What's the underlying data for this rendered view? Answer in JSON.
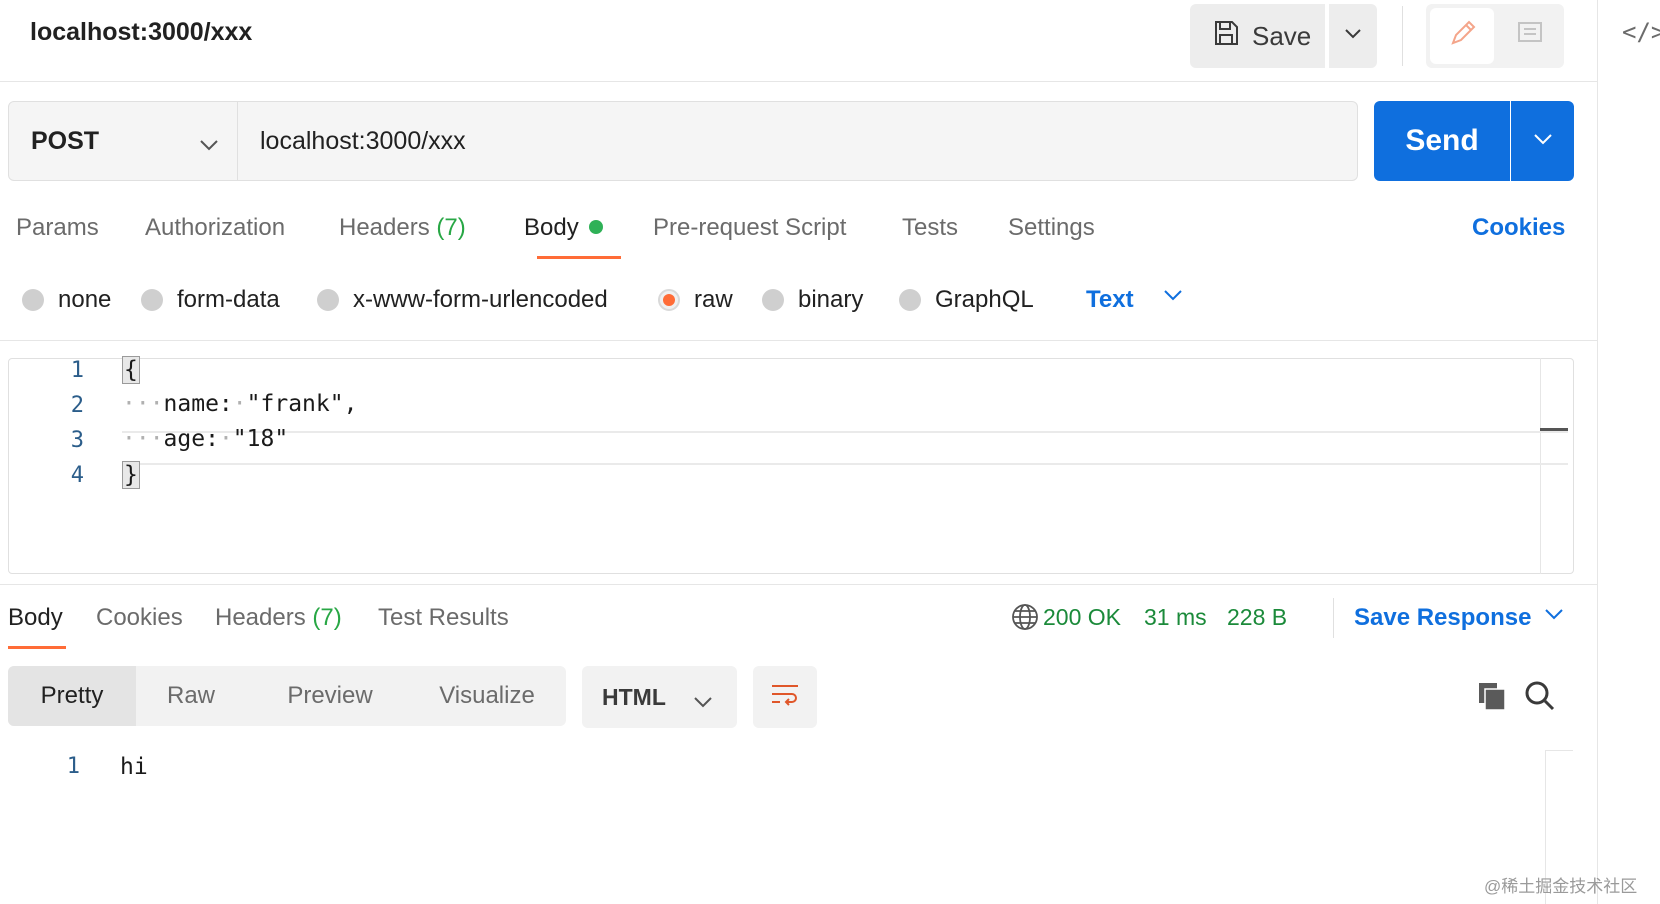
{
  "window": {
    "title": "localhost:3000/xxx"
  },
  "toolbar": {
    "save_label": "Save"
  },
  "request": {
    "method": "POST",
    "url": "localhost:3000/xxx",
    "send_label": "Send"
  },
  "request_tabs": [
    {
      "label": "Params"
    },
    {
      "label": "Authorization"
    },
    {
      "label": "Headers",
      "count": "(7)"
    },
    {
      "label": "Body"
    },
    {
      "label": "Pre-request Script"
    },
    {
      "label": "Tests"
    },
    {
      "label": "Settings"
    }
  ],
  "cookies_label": "Cookies",
  "body_types": [
    {
      "label": "none"
    },
    {
      "label": "form-data"
    },
    {
      "label": "x-www-form-urlencoded"
    },
    {
      "label": "raw"
    },
    {
      "label": "binary"
    },
    {
      "label": "GraphQL"
    }
  ],
  "body_format": "Text",
  "request_body": {
    "line_numbers": [
      "1",
      "2",
      "3",
      "4"
    ],
    "line1": "{",
    "line2_indent": "···",
    "line2_code": "name:",
    "line2_ws": "·",
    "line2_value": "\"frank\",",
    "line3_indent": "···",
    "line3_code": "age:",
    "line3_ws": "·",
    "line3_value": "\"18\"",
    "line4": "}"
  },
  "response_tabs": [
    {
      "label": "Body"
    },
    {
      "label": "Cookies"
    },
    {
      "label": "Headers",
      "count": "(7)"
    },
    {
      "label": "Test Results"
    }
  ],
  "response_status": {
    "code": "200 OK",
    "time": "31 ms",
    "size": "228 B"
  },
  "save_response_label": "Save Response",
  "view_modes": [
    {
      "label": "Pretty"
    },
    {
      "label": "Raw"
    },
    {
      "label": "Preview"
    },
    {
      "label": "Visualize"
    }
  ],
  "response_format": "HTML",
  "response_body": {
    "line_number": "1",
    "line1": "hi"
  },
  "watermark": "@稀土掘金技术社区",
  "colors": {
    "accent_orange": "#ff6c37",
    "primary_blue": "#0f6fde",
    "success_green": "#28a745"
  }
}
